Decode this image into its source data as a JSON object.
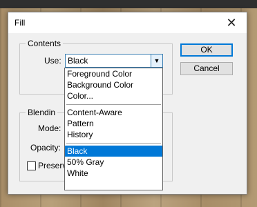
{
  "dialog": {
    "title": "Fill",
    "close_glyph": "✕"
  },
  "contents": {
    "legend": "Contents",
    "use_label": "Use:",
    "use_value": "Black",
    "dropdown_arrow": "▼",
    "options_group1": [
      "Foreground Color",
      "Background Color",
      "Color..."
    ],
    "options_group2": [
      "Content-Aware",
      "Pattern",
      "History"
    ],
    "options_group3": [
      "Black",
      "50% Gray",
      "White"
    ],
    "selected_option": "Black"
  },
  "blending": {
    "legend": "Blendin",
    "mode_label": "Mode:",
    "opacity_label": "Opacity:",
    "preserve_label": "Preserv"
  },
  "buttons": {
    "ok": "OK",
    "cancel": "Cancel"
  }
}
